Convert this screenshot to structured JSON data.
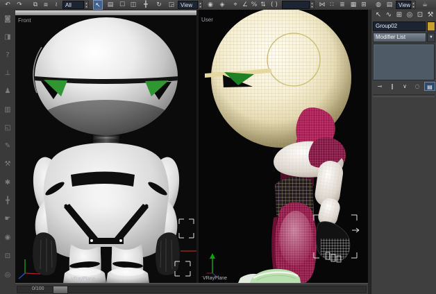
{
  "toolbar": {
    "select_filter_value": "All",
    "coord_system_value": "View",
    "named_sets_value": "",
    "view_preset_value": "View",
    "icons": {
      "undo": "↶",
      "redo": "↷",
      "select_link": "⧉",
      "unlink": "⧈",
      "bind_spacewarp": "≀",
      "select_object": "↖",
      "select_by_name": "▤",
      "rect_region": "☐",
      "window_crossing": "◫",
      "move": "╋",
      "rotate": "↻",
      "scale": "◲",
      "pivot_center": "◉",
      "manipulate": "◈",
      "snap_3d": "⌖",
      "snap_angle": "∠",
      "snap_percent": "%",
      "snap_spinner": "⇅",
      "kbd_override": "( )",
      "mirror": "⋈",
      "align": "∷",
      "layer_manager": "≣",
      "curve_editor": "▦",
      "schematic_view": "⊞",
      "material_editor": "◍",
      "render_setup": "▤",
      "render": "☕",
      "spinner_up": "▴",
      "spinner_down": "▾",
      "dropdown_arrow": "▼"
    }
  },
  "left_toolbar": {
    "icons": {
      "lock": "◙",
      "mirror_tool": "◨",
      "help": "?",
      "level": "⊥",
      "sculpt": "♟",
      "image": "▥",
      "box": "◱",
      "pen": "✎",
      "hammer": "⚒",
      "flower": "✱",
      "move_tool": "╋",
      "hand": "☛",
      "camera": "◉",
      "monitor": "⊡",
      "sphere": "◎"
    }
  },
  "viewports": {
    "left": {
      "label": "Front",
      "object_label": "VRayPlane"
    },
    "right": {
      "label": "User",
      "object_label": "VRayPlane"
    }
  },
  "command_panel": {
    "tabs": {
      "create": "↖",
      "modify": "∿",
      "hierarchy": "⊞",
      "motion": "◎",
      "display": "⊡",
      "utilities": "⚒"
    },
    "object_name": "Group02",
    "modifier_list_label": "Modifier List",
    "stack_buttons": {
      "pin_stack": "⊸",
      "show_end_result": "∥",
      "make_unique": "∨",
      "remove_modifier": "◌",
      "configure_sets": "▤"
    }
  },
  "timeline": {
    "frame_label": "0/100"
  },
  "colors": {
    "wirecolor_swatch": "#c79f2e",
    "eye_green": "#2f9632",
    "wireframe_tan": "#d3c68c",
    "wireframe_pink": "#ee6da0",
    "shoe_green": "#badfae",
    "selection_red": "#b52a22",
    "active_tool_blue": "#44628e"
  }
}
